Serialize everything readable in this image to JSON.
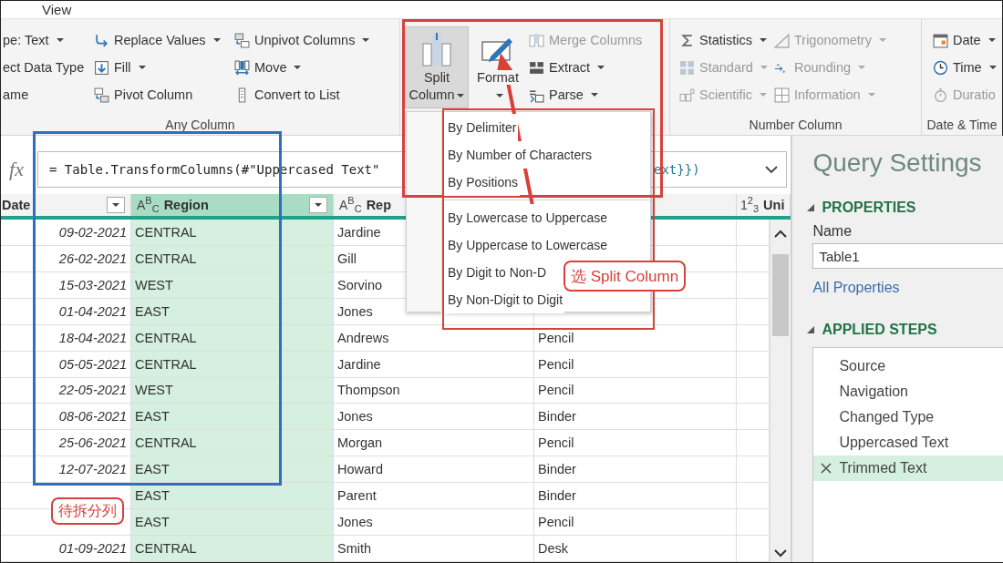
{
  "menu_bar": [
    "View"
  ],
  "ribbon": {
    "groups": [
      {
        "label": "Any Column",
        "columns": [
          [
            {
              "label": "pe: Text",
              "dropdown": true,
              "disabled": false
            },
            {
              "label": "ect Data Type",
              "dropdown": false,
              "disabled": false
            },
            {
              "label": "ame",
              "dropdown": false,
              "disabled": false
            }
          ],
          [
            {
              "label": "Replace Values",
              "dropdown": true,
              "disabled": false
            },
            {
              "label": "Fill",
              "dropdown": true,
              "disabled": false
            },
            {
              "label": "Pivot Column",
              "dropdown": false,
              "disabled": false
            }
          ],
          [
            {
              "label": "Unpivot Columns",
              "dropdown": true,
              "disabled": false
            },
            {
              "label": "Move",
              "dropdown": true,
              "disabled": false
            },
            {
              "label": "Convert to List",
              "dropdown": false,
              "disabled": false
            }
          ]
        ]
      },
      {
        "large": [
          {
            "label": "Split Column",
            "selected": true
          },
          {
            "label": "Format",
            "selected": false
          }
        ],
        "columns": [
          [
            {
              "label": "Merge Columns",
              "dropdown": false,
              "disabled": true
            },
            {
              "label": "Extract",
              "dropdown": true,
              "disabled": false
            },
            {
              "label": "Parse",
              "dropdown": true,
              "disabled": false
            }
          ]
        ]
      },
      {
        "label": "Number Column",
        "columns": [
          [
            {
              "label": "Statistics",
              "dropdown": true,
              "disabled": false
            },
            {
              "label": "Standard",
              "dropdown": true,
              "disabled": true
            },
            {
              "label": "Scientific",
              "dropdown": true,
              "disabled": true
            }
          ],
          [
            {
              "label": "Trigonometry",
              "dropdown": true,
              "disabled": true
            },
            {
              "label": "Rounding",
              "dropdown": true,
              "disabled": true
            },
            {
              "label": "Information",
              "dropdown": true,
              "disabled": true
            }
          ]
        ]
      },
      {
        "label": "Date & Time",
        "columns": [
          [
            {
              "label": "Date",
              "dropdown": true,
              "disabled": false
            },
            {
              "label": "Time",
              "dropdown": true,
              "disabled": false
            },
            {
              "label": "Duratio",
              "dropdown": false,
              "disabled": true
            }
          ]
        ]
      }
    ]
  },
  "split_menu": {
    "sections": [
      [
        {
          "label": "By Delimiter"
        },
        {
          "label": "By Number of Characters"
        },
        {
          "label": "By Positions"
        }
      ],
      [
        {
          "label": "By Lowercase to Uppercase"
        },
        {
          "label": "By Uppercase to Lowercase"
        },
        {
          "label": "By Digit to Non-D"
        },
        {
          "label": "By Non-Digit to Digit"
        }
      ]
    ]
  },
  "formula_bar": {
    "label": "fx",
    "text_before": "= Table.TransformColumns(#\"Uppercased Text\"",
    "text_after": "ext}})"
  },
  "table": {
    "columns": [
      {
        "name": "Date",
        "selected": false
      },
      {
        "type": "A$^{B}$$_{C}$",
        "name": "Region",
        "selected": true
      },
      {
        "type": "A$^{B}$$_{C}$",
        "name": "Rep",
        "selected": false
      },
      {
        "selected": false
      },
      {
        "type": "1$^{2}$$_{3}$",
        "name": "Uni",
        "selected": false
      }
    ],
    "rows": [
      {
        "date": "09-02-2021",
        "region": "CENTRAL",
        "rep": "Jardine"
      },
      {
        "date": "26-02-2021",
        "region": "CENTRAL",
        "rep": "Gill"
      },
      {
        "date": "15-03-2021",
        "region": "WEST",
        "rep": "Sorvino"
      },
      {
        "date": "01-04-2021",
        "region": "EAST",
        "rep": "Jones"
      },
      {
        "date": "18-04-2021",
        "region": "CENTRAL",
        "rep": "Andrews",
        "column_4": "Pencil"
      },
      {
        "date": "05-05-2021",
        "region": "CENTRAL",
        "rep": "Jardine",
        "column_4": "Pencil"
      },
      {
        "date": "22-05-2021",
        "region": "WEST",
        "rep": "Thompson",
        "column_4": "Pencil"
      },
      {
        "date": "08-06-2021",
        "region": "EAST",
        "rep": "Jones",
        "column_4": "Binder"
      },
      {
        "date": "25-06-2021",
        "region": "CENTRAL",
        "rep": "Morgan",
        "column_4": "Pencil"
      },
      {
        "date": "12-07-2021",
        "region": "EAST",
        "rep": "Howard",
        "column_4": "Binder"
      },
      {
        "region": "EAST",
        "rep": "Parent",
        "column_4": "Binder"
      },
      {
        "region": "EAST",
        "rep": "Jones",
        "column_4": "Pencil"
      },
      {
        "date": "01-09-2021",
        "region": "CENTRAL",
        "rep": "Smith",
        "column_4": "Desk"
      }
    ]
  },
  "query_settings": {
    "title": "Query Settings",
    "properties": {
      "heading": "PROPERTIES",
      "expanded": true,
      "name_label": "Name",
      "name_value": "Table1",
      "link": "All Properties"
    },
    "applied_steps": {
      "heading": "APPLIED STEPS",
      "expanded": true,
      "steps": [
        {
          "label": "Source",
          "selected": false
        },
        {
          "label": "Navigation",
          "selected": false
        },
        {
          "label": "Changed Type",
          "selected": false
        },
        {
          "label": "Uppercased Text",
          "selected": false
        },
        {
          "label": "Trimmed Text",
          "selected": true
        }
      ]
    }
  },
  "annotations": [
    {
      "kind": "box",
      "color": "#d9403a"
    },
    {
      "kind": "box",
      "color": "#d9403a"
    },
    {
      "kind": "box",
      "color": "#2f6fc0"
    },
    {
      "kind": "arrow",
      "color": "#d9403a"
    },
    {
      "kind": "callout",
      "color": "#d9403a",
      "text": "选 Split Column"
    },
    {
      "kind": "callout",
      "color": "#d9403a",
      "text": "待拆分列"
    }
  ]
}
